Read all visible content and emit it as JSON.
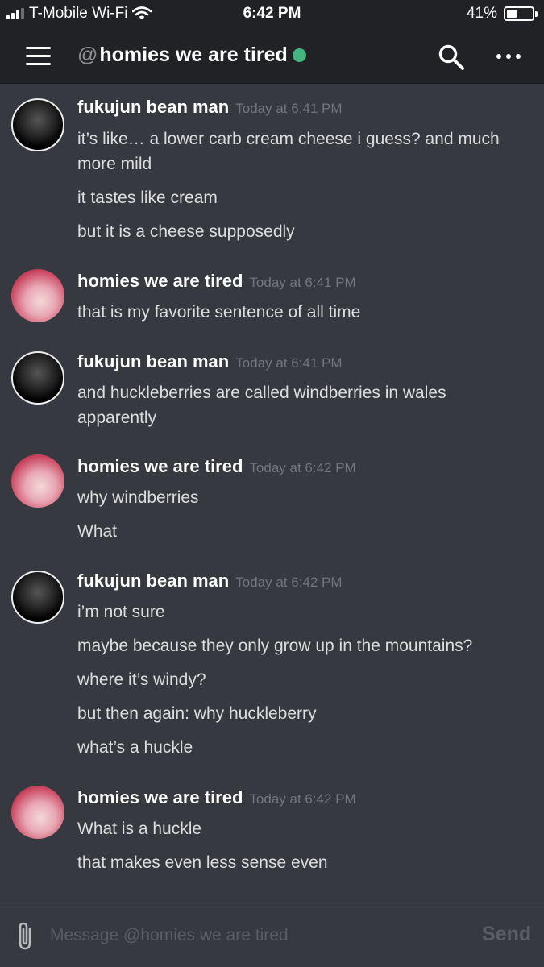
{
  "status_bar": {
    "carrier": "T-Mobile Wi-Fi",
    "time": "6:42 PM",
    "battery": "41%",
    "battery_level": 0.41,
    "icons": [
      "signal-icon",
      "wifi-icon",
      "battery-icon"
    ]
  },
  "header": {
    "at_symbol": "@",
    "channel_name": "homies we are tired",
    "online_color": "#43b581",
    "icons": [
      "menu-icon",
      "search-icon",
      "more-icon"
    ]
  },
  "messages": [
    {
      "author": "fukujun bean man",
      "timestamp": "Today at 6:41 PM",
      "lines": [
        "it’s like… a lower carb cream cheese i guess? and much more mild",
        "it tastes like cream",
        "but it is a cheese supposedly"
      ]
    },
    {
      "author": "homies we are tired",
      "timestamp": "Today at 6:41 PM",
      "lines": [
        "that is my favorite sentence of all time"
      ]
    },
    {
      "author": "fukujun bean man",
      "timestamp": "Today at 6:41 PM",
      "lines": [
        "and huckleberries are called windberries in wales apparently"
      ]
    },
    {
      "author": "homies we are tired",
      "timestamp": "Today at 6:42 PM",
      "lines": [
        "why windberries",
        "What"
      ]
    },
    {
      "author": "fukujun bean man",
      "timestamp": "Today at 6:42 PM",
      "lines": [
        "i’m not sure",
        "maybe because they only grow up in the mountains?",
        "where it’s windy?",
        "but then again: why huckleberry",
        "what’s a huckle"
      ]
    },
    {
      "author": "homies we are tired",
      "timestamp": "Today at 6:42 PM",
      "lines": [
        "What is a huckle",
        "that makes even less sense even"
      ]
    }
  ],
  "composer": {
    "placeholder": "Message @homies we are tired",
    "send_label": "Send"
  },
  "colors": {
    "background": "#36393f",
    "header": "#202225",
    "text": "#dcddde",
    "muted": "#72767d"
  }
}
